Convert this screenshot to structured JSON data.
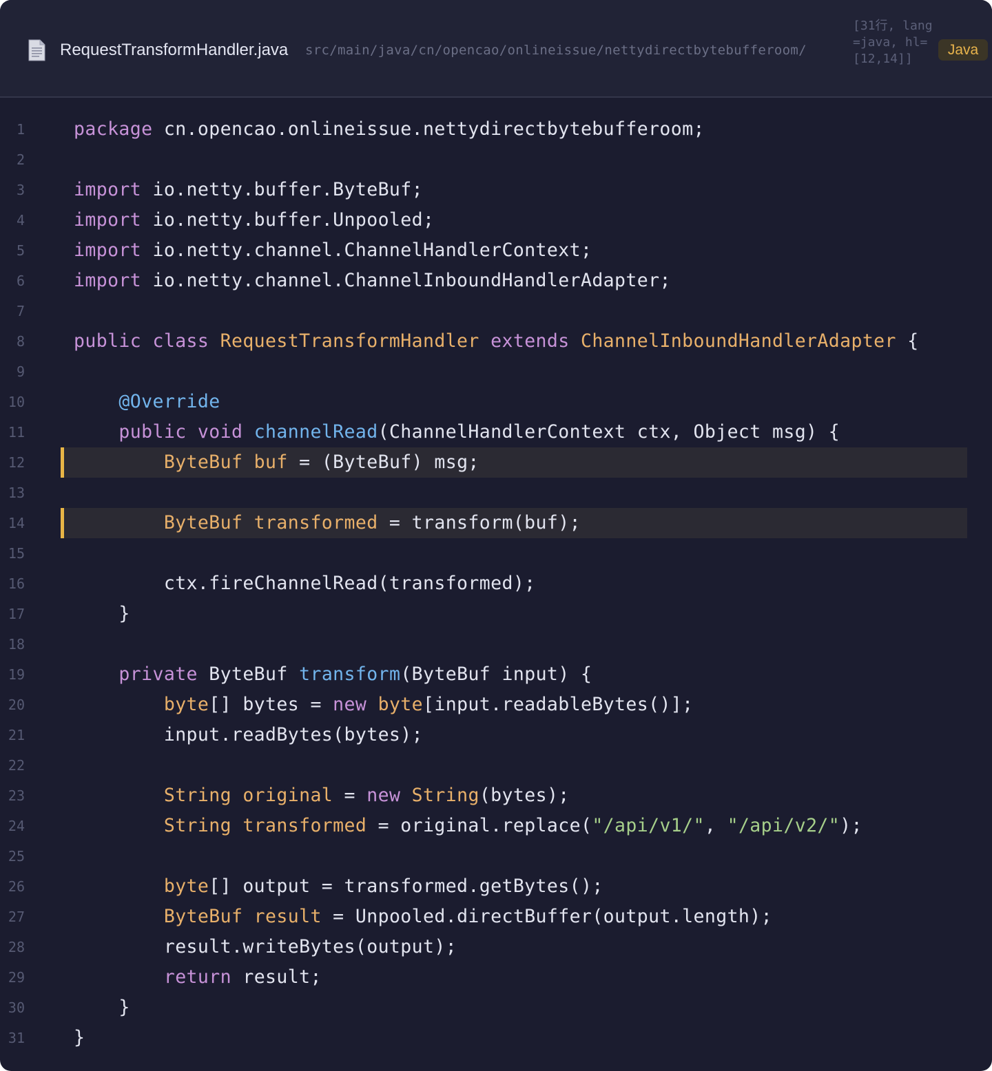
{
  "header": {
    "file_icon": "document-icon",
    "file_name": "RequestTransformHandler.java",
    "path": "src/main/java/cn/opencao/onlineissue/nettydirectbytebufferoom/",
    "meta": "[31行, lang=java, hl= [12,14]]",
    "language_badge": "Java"
  },
  "colors": {
    "background": "#1b1c2f",
    "header_background": "#212336",
    "keyword": "#c792d8",
    "type": "#e8b06a",
    "function": "#72b4ec",
    "string": "#a6cf8a",
    "plain": "#e2e4ef",
    "highlight_bar": "#e8b546"
  },
  "highlighted_lines": [
    12,
    14
  ],
  "lines": [
    {
      "n": "1",
      "tokens": [
        [
          "kw",
          "package"
        ],
        [
          "pl",
          " cn.opencao.onlineissue.nettydirectbytebufferoom;"
        ]
      ]
    },
    {
      "n": "2",
      "tokens": []
    },
    {
      "n": "3",
      "tokens": [
        [
          "kw",
          "import"
        ],
        [
          "pl",
          " io.netty.buffer.ByteBuf;"
        ]
      ]
    },
    {
      "n": "4",
      "tokens": [
        [
          "kw",
          "import"
        ],
        [
          "pl",
          " io.netty.buffer.Unpooled;"
        ]
      ]
    },
    {
      "n": "5",
      "tokens": [
        [
          "kw",
          "import"
        ],
        [
          "pl",
          " io.netty.channel.ChannelHandlerContext;"
        ]
      ]
    },
    {
      "n": "6",
      "tokens": [
        [
          "kw",
          "import"
        ],
        [
          "pl",
          " io.netty.channel.ChannelInboundHandlerAdapter;"
        ]
      ]
    },
    {
      "n": "7",
      "tokens": []
    },
    {
      "n": "8",
      "tokens": [
        [
          "kw",
          "public class "
        ],
        [
          "ty",
          "RequestTransformHandler "
        ],
        [
          "kw",
          "extends "
        ],
        [
          "ty",
          "ChannelInboundHandlerAdapter"
        ],
        [
          "pl",
          " {"
        ]
      ]
    },
    {
      "n": "9",
      "tokens": []
    },
    {
      "n": "10",
      "tokens": [
        [
          "pl",
          "    "
        ],
        [
          "an",
          "@Override"
        ]
      ]
    },
    {
      "n": "11",
      "tokens": [
        [
          "pl",
          "    "
        ],
        [
          "kw",
          "public void "
        ],
        [
          "fn",
          "channelRead"
        ],
        [
          "pl",
          "(ChannelHandlerContext ctx, Object msg) {"
        ]
      ]
    },
    {
      "n": "12",
      "tokens": [
        [
          "pl",
          "        "
        ],
        [
          "ty",
          "ByteBuf buf"
        ],
        [
          "pl",
          " = (ByteBuf) msg;"
        ]
      ]
    },
    {
      "n": "13",
      "tokens": []
    },
    {
      "n": "14",
      "tokens": [
        [
          "pl",
          "        "
        ],
        [
          "ty",
          "ByteBuf transformed"
        ],
        [
          "pl",
          " = transform(buf);"
        ]
      ]
    },
    {
      "n": "15",
      "tokens": []
    },
    {
      "n": "16",
      "tokens": [
        [
          "pl",
          "        ctx.fireChannelRead(transformed);"
        ]
      ]
    },
    {
      "n": "17",
      "tokens": [
        [
          "pl",
          "    }"
        ]
      ]
    },
    {
      "n": "18",
      "tokens": []
    },
    {
      "n": "19",
      "tokens": [
        [
          "pl",
          "    "
        ],
        [
          "kw",
          "private"
        ],
        [
          "pl",
          " ByteBuf "
        ],
        [
          "fn",
          "transform"
        ],
        [
          "pl",
          "(ByteBuf input) {"
        ]
      ]
    },
    {
      "n": "20",
      "tokens": [
        [
          "pl",
          "        "
        ],
        [
          "ty",
          "byte"
        ],
        [
          "pl",
          "[] bytes = "
        ],
        [
          "kw",
          "new "
        ],
        [
          "ty",
          "byte"
        ],
        [
          "pl",
          "[input.readableBytes()];"
        ]
      ]
    },
    {
      "n": "21",
      "tokens": [
        [
          "pl",
          "        input.readBytes(bytes);"
        ]
      ]
    },
    {
      "n": "22",
      "tokens": []
    },
    {
      "n": "23",
      "tokens": [
        [
          "pl",
          "        "
        ],
        [
          "ty",
          "String original"
        ],
        [
          "pl",
          " = "
        ],
        [
          "kw",
          "new "
        ],
        [
          "ty",
          "String"
        ],
        [
          "pl",
          "(bytes);"
        ]
      ]
    },
    {
      "n": "24",
      "tokens": [
        [
          "pl",
          "        "
        ],
        [
          "ty",
          "String transformed"
        ],
        [
          "pl",
          " = original.replace("
        ],
        [
          "st",
          "\"/api/v1/\""
        ],
        [
          "pl",
          ", "
        ],
        [
          "st",
          "\"/api/v2/\""
        ],
        [
          "pl",
          ");"
        ]
      ]
    },
    {
      "n": "25",
      "tokens": []
    },
    {
      "n": "26",
      "tokens": [
        [
          "pl",
          "        "
        ],
        [
          "ty",
          "byte"
        ],
        [
          "pl",
          "[] output = transformed.getBytes();"
        ]
      ]
    },
    {
      "n": "27",
      "tokens": [
        [
          "pl",
          "        "
        ],
        [
          "ty",
          "ByteBuf result"
        ],
        [
          "pl",
          " = Unpooled.directBuffer(output.length);"
        ]
      ]
    },
    {
      "n": "28",
      "tokens": [
        [
          "pl",
          "        result.writeBytes(output);"
        ]
      ]
    },
    {
      "n": "29",
      "tokens": [
        [
          "pl",
          "        "
        ],
        [
          "kw",
          "return"
        ],
        [
          "pl",
          " result;"
        ]
      ]
    },
    {
      "n": "30",
      "tokens": [
        [
          "pl",
          "    }"
        ]
      ]
    },
    {
      "n": "31",
      "tokens": [
        [
          "pl",
          "}"
        ]
      ]
    }
  ]
}
